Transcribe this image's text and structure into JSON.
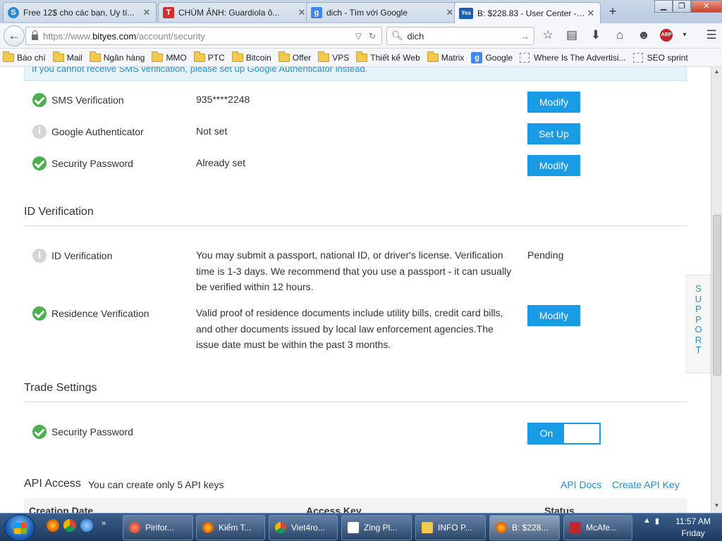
{
  "browser": {
    "tabs": [
      {
        "label": "Free 12$ cho các bạn, Uy tí...",
        "favicon": "S",
        "color": "#2a8ccf"
      },
      {
        "label": "CHÙM ẢNH: Guardiola ô...",
        "favicon": "T",
        "color": "#d32f2f"
      },
      {
        "label": "dich - Tìm với Google",
        "favicon": "g",
        "color": "#4285f4"
      },
      {
        "label": "B: $228.83 - User Center - B...",
        "favicon": "Yes",
        "color": "#1a5fb4"
      }
    ],
    "new_tab": "+",
    "url": {
      "scheme": "https://www.",
      "host": "bityes.com",
      "path": "/account/security"
    },
    "search_text": "dich",
    "bookmarks": [
      {
        "label": "Báo chí",
        "type": "folder"
      },
      {
        "label": "Mail",
        "type": "folder"
      },
      {
        "label": "Ngân hàng",
        "type": "folder"
      },
      {
        "label": "MMO",
        "type": "folder"
      },
      {
        "label": "PTC",
        "type": "folder"
      },
      {
        "label": "Bitcoin",
        "type": "folder"
      },
      {
        "label": "Offer",
        "type": "folder"
      },
      {
        "label": "VPS",
        "type": "folder"
      },
      {
        "label": "Thiết kế Web",
        "type": "folder"
      },
      {
        "label": "Matrix",
        "type": "folder"
      },
      {
        "label": "Google",
        "type": "google"
      },
      {
        "label": "Where Is The Advertisi...",
        "type": "blank"
      },
      {
        "label": "SEO sprint",
        "type": "blank"
      }
    ]
  },
  "page": {
    "notice": "If you cannot receive SMS verification, please set up Google Authenticator instead.",
    "security": {
      "sms": {
        "label": "SMS Verification",
        "value": "935****2248",
        "button": "Modify"
      },
      "google_auth": {
        "label": "Google Authenticator",
        "value": "Not set",
        "button": "Set Up"
      },
      "password": {
        "label": "Security Password",
        "value": "Already set",
        "button": "Modify"
      }
    },
    "id_section": {
      "title": "ID Verification",
      "id": {
        "label": "ID Verification",
        "desc": "You may submit a passport, national ID, or driver's license. Verification time is 1-3 days. We recommend that you use a passport - it can usually be verified within 12 hours.",
        "status": "Pending"
      },
      "residence": {
        "label": "Residence Verification",
        "desc": "Valid proof of residence documents include utility bills, credit card bills, and other documents issued by local law enforcement agencies.The issue date must be within the past 3 months.",
        "button": "Modify"
      }
    },
    "trade": {
      "title": "Trade Settings",
      "password_label": "Security Password",
      "toggle": "On"
    },
    "api": {
      "title": "API Access",
      "note": "You can create only 5 API keys",
      "docs_link": "API Docs",
      "create_link": "Create API Key",
      "columns": [
        "Creation Date",
        "Access Key",
        "Status"
      ]
    },
    "support_tab": [
      "S",
      "U",
      "P",
      "P",
      "O",
      "R",
      "T"
    ]
  },
  "taskbar": {
    "tasks": [
      {
        "label": "Pirifor...",
        "icon": "ccleaner"
      },
      {
        "label": "Kiểm T...",
        "icon": "ff"
      },
      {
        "label": "Viet4ro...",
        "icon": "chrome"
      },
      {
        "label": "Zing Pl...",
        "icon": "zing"
      },
      {
        "label": "INFO P...",
        "icon": "folder"
      },
      {
        "label": "B: $228...",
        "icon": "ff"
      },
      {
        "label": "McAfe...",
        "icon": "mcafee"
      }
    ],
    "time": "11:57 AM",
    "day": "Friday"
  }
}
